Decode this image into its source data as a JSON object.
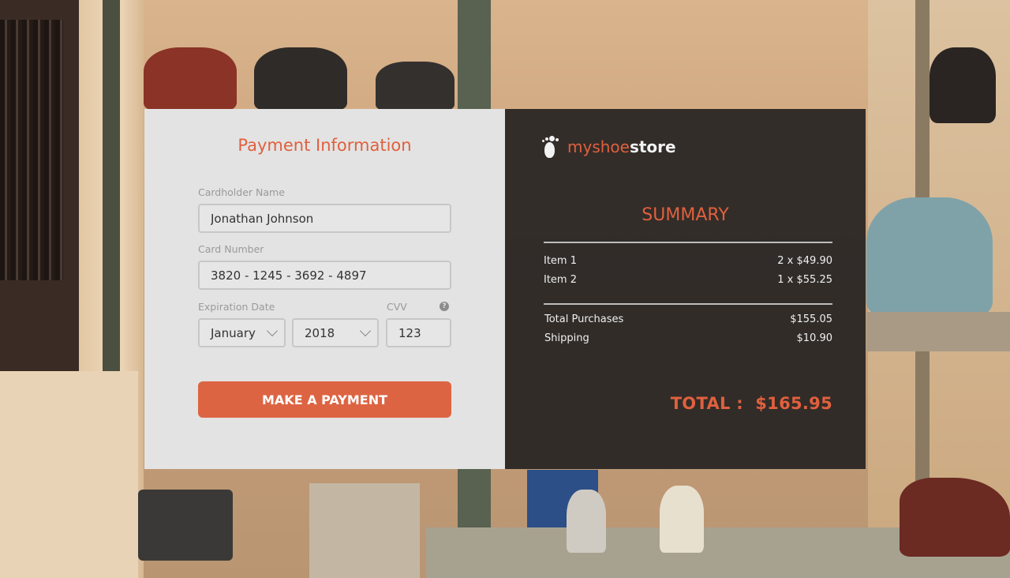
{
  "payment": {
    "title": "Payment Information",
    "cardholder_label": "Cardholder Name",
    "cardholder_value": "Jonathan Johnson",
    "card_number_label": "Card Number",
    "card_number_value": "3820 - 1245 - 3692 - 4897",
    "expiration_label": "Expiration Date",
    "month_value": "January",
    "year_value": "2018",
    "cvv_label": "CVV",
    "cvv_value": "123",
    "help_icon": "?",
    "submit_label": "MAKE A PAYMENT"
  },
  "brand": {
    "name_part1": "myshoe",
    "name_part2": "store",
    "icon": "footprint-icon"
  },
  "summary": {
    "title": "SUMMARY",
    "items": [
      {
        "name": "Item 1",
        "qty_price": "2 x $49.90"
      },
      {
        "name": "Item 2",
        "qty_price": "1 x $55.25"
      }
    ],
    "totals": [
      {
        "label": "Total Purchases",
        "value": "$155.05"
      },
      {
        "label": "Shipping",
        "value": "$10.90"
      }
    ],
    "total_label": "TOTAL :",
    "total_value": "$165.95"
  },
  "colors": {
    "accent": "#dd6442",
    "left_panel": "#e3e3e3",
    "right_panel": "#262422"
  }
}
